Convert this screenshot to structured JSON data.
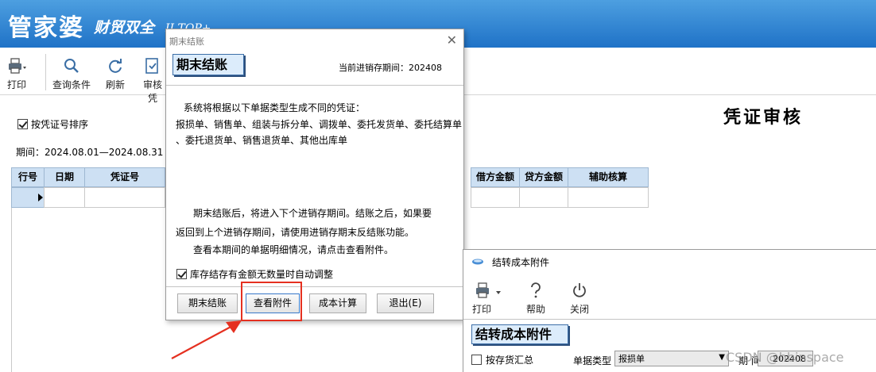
{
  "app": {
    "brand_main": "管家婆",
    "brand_sub": "财贸双全",
    "brand_tail": "II TOP+"
  },
  "toolbar": {
    "print_label": "打印",
    "query_label": "查询条件",
    "refresh_label": "刷新",
    "audit_label": "审核凭"
  },
  "page": {
    "sort_by_voucher_label": "按凭证号排序",
    "sort_by_voucher_checked": true,
    "period_label": "期间：2024.08.01—2024.08.31",
    "title": "凭证审核"
  },
  "voucher_table": {
    "columns": [
      "行号",
      "日期",
      "凭证号",
      "借方金额",
      "贷方金额",
      "辅助核算"
    ]
  },
  "close_dialog": {
    "window_title": "期末结账",
    "heading": "期末结账",
    "current_period": "当前进销存期间：202408",
    "intro": "系统将根据以下单据类型生成不同的凭证：",
    "doc_types_line1": "报损单、销售单、组装与拆分单、调拨单、委托发货单、委托结算单",
    "doc_types_line2": "、委托退货单、销售退货单、其他出库单",
    "note_line1": "期末结账后，将进入下个进销存期间。结账之后，如果要",
    "note_line2": "返回到上个进销存期间，请使用进销存期末反结账功能。",
    "note_line3": "查看本期间的单据明细情况，请点击查看附件。",
    "auto_adjust_label": "库存结存有金额无数量时自动调整",
    "auto_adjust_checked": true,
    "btn_close": "期末结账",
    "btn_view_attachment": "查看附件",
    "btn_cost_calc": "成本计算",
    "btn_exit": "退出(E)"
  },
  "cost_dialog": {
    "window_title": "结转成本附件",
    "print_label": "打印",
    "help_label": "帮助",
    "close_label": "关闭",
    "heading": "结转成本附件",
    "summary_by_inventory_label": "按存货汇总",
    "summary_by_inventory_checked": false,
    "doc_type_label": "单据类型",
    "doc_type_value": "报损单",
    "period_label": "期 间",
    "period_value": "202408"
  },
  "watermark": "CSDN @hbinspace",
  "colors": {
    "banner": "#1f72c7",
    "grid_header": "#cde0f3",
    "badge_fill": "#dcecfb",
    "annotation_red": "#e53020"
  }
}
